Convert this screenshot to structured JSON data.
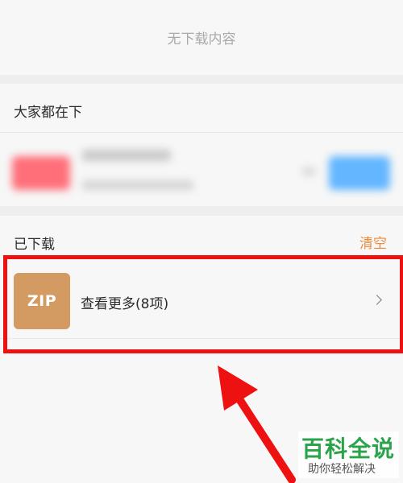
{
  "empty_state": {
    "text": "无下载内容"
  },
  "popular": {
    "title": "大家都在下"
  },
  "downloaded": {
    "title": "已下载",
    "clear_label": "清空",
    "item": {
      "icon_label": "ZIP",
      "label": "查看更多(8项)"
    }
  },
  "watermark": {
    "title": "百科全说",
    "subtitle": "助你轻松解决"
  },
  "colors": {
    "accent_orange": "#f08a3a",
    "zip_icon": "#d39a62",
    "highlight_red": "#ee1111",
    "watermark_green": "#2aa34a"
  }
}
